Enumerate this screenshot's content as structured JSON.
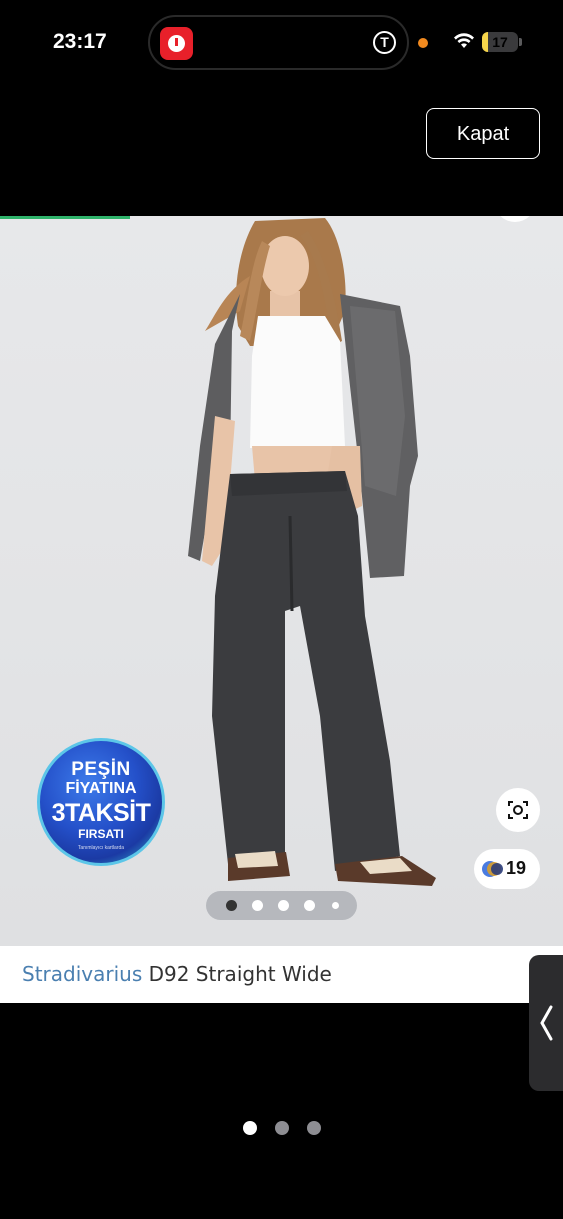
{
  "status_bar": {
    "time": "23:17",
    "island_indicator": "T",
    "battery_level": "17",
    "battery_fraction": 0.17,
    "icons": [
      "timer-app-icon",
      "orange-dot-icon",
      "wifi-icon",
      "battery-icon"
    ]
  },
  "header": {
    "close_label": "Kapat"
  },
  "product": {
    "brand": "Stradivarius",
    "name": "D92 Straight Wide",
    "color_count": "19",
    "image_index": 1,
    "image_total": 5,
    "promo_badge": {
      "line1": "PEŞİN",
      "line2": "FİYATINA",
      "line3": "3TAKSİT",
      "line4": "FIRSATI",
      "line5": "Tanımlayıcı kartlarda"
    },
    "swatch_colors": [
      "#4a7be0",
      "#e0a020",
      "#2a3c7a"
    ]
  },
  "carousel": {
    "page_count": 3,
    "active_page": 1
  },
  "colors": {
    "progress": "#2fb36b",
    "brand_text": "#4a7fb0",
    "title_text": "#333333",
    "battery": "#f6d54b"
  }
}
